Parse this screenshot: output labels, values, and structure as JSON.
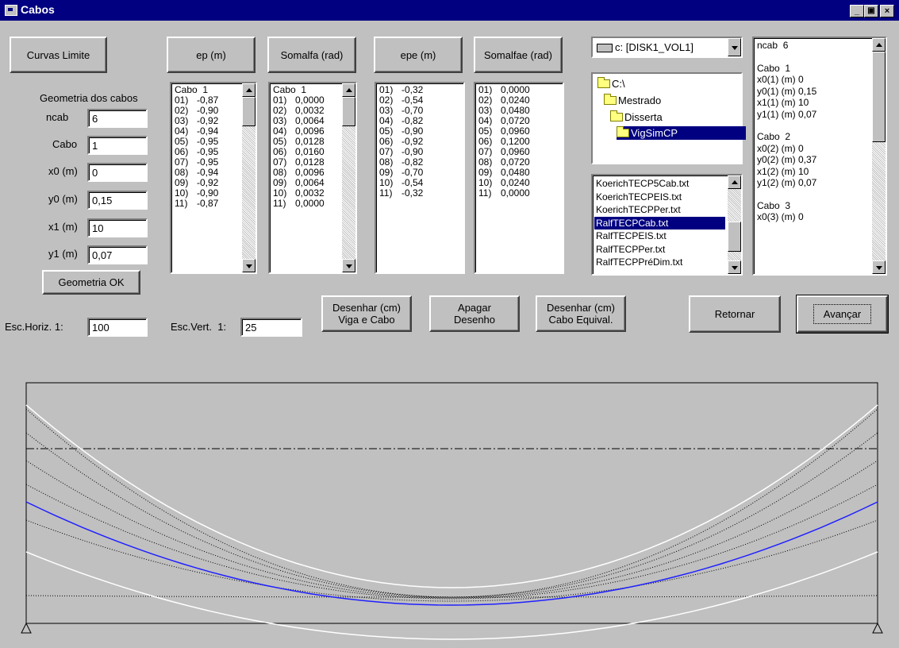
{
  "window": {
    "title": "Cabos",
    "min": "_",
    "max": " ",
    "close": "×"
  },
  "buttons": {
    "curvas_limite": "Curvas Limite",
    "ep": "ep (m)",
    "somalfa": "Somalfa (rad)",
    "epe": "epe (m)",
    "somalfae": "Somalfae (rad)",
    "geometria_ok": "Geometria OK",
    "desenhar_viga_l1": "Desenhar (cm)",
    "desenhar_viga_l2": "Viga e Cabo",
    "apagar_l1": "Apagar",
    "apagar_l2": "Desenho",
    "desenhar_cabo_l1": "Desenhar (cm)",
    "desenhar_cabo_l2": "Cabo Equival.",
    "retornar": "Retornar",
    "avancar": "Avançar"
  },
  "geometry": {
    "heading": "Geometria dos cabos",
    "ncab_label": "ncab",
    "ncab": "6",
    "cabo_label": "Cabo",
    "cabo": "1",
    "x0_label": "x0 (m)",
    "x0": "0",
    "y0_label": "y0 (m)",
    "y0": "0,15",
    "x1_label": "x1 (m)",
    "x1": "10",
    "y1_label": "y1 (m)",
    "y1": "0,07"
  },
  "scales": {
    "horiz_label": "Esc.Horiz. 1:",
    "horiz": "100",
    "vert_label": "Esc.Vert.  1:",
    "vert": "25"
  },
  "ep_list": {
    "header": "Cabo  1",
    "rows": [
      [
        "01)",
        "-0,87"
      ],
      [
        "02)",
        "-0,90"
      ],
      [
        "03)",
        "-0,92"
      ],
      [
        "04)",
        "-0,94"
      ],
      [
        "05)",
        "-0,95"
      ],
      [
        "06)",
        "-0,95"
      ],
      [
        "07)",
        "-0,95"
      ],
      [
        "08)",
        "-0,94"
      ],
      [
        "09)",
        "-0,92"
      ],
      [
        "10)",
        "-0,90"
      ],
      [
        "11)",
        "-0,87"
      ]
    ]
  },
  "somalfa_list": {
    "header": "Cabo  1",
    "rows": [
      [
        "01)",
        "0,0000"
      ],
      [
        "02)",
        "0,0032"
      ],
      [
        "03)",
        "0,0064"
      ],
      [
        "04)",
        "0,0096"
      ],
      [
        "05)",
        "0,0128"
      ],
      [
        "06)",
        "0,0160"
      ],
      [
        "07)",
        "0,0128"
      ],
      [
        "08)",
        "0,0096"
      ],
      [
        "09)",
        "0,0064"
      ],
      [
        "10)",
        "0,0032"
      ],
      [
        "11)",
        "0,0000"
      ]
    ]
  },
  "epe_list": {
    "rows": [
      [
        "01)",
        "-0,32"
      ],
      [
        "02)",
        "-0,54"
      ],
      [
        "03)",
        "-0,70"
      ],
      [
        "04)",
        "-0,82"
      ],
      [
        "05)",
        "-0,90"
      ],
      [
        "06)",
        "-0,92"
      ],
      [
        "07)",
        "-0,90"
      ],
      [
        "08)",
        "-0,82"
      ],
      [
        "09)",
        "-0,70"
      ],
      [
        "10)",
        "-0,54"
      ],
      [
        "11)",
        "-0,32"
      ]
    ]
  },
  "somalfae_list": {
    "rows": [
      [
        "01)",
        "0,0000"
      ],
      [
        "02)",
        "0,0240"
      ],
      [
        "03)",
        "0,0480"
      ],
      [
        "04)",
        "0,0720"
      ],
      [
        "05)",
        "0,0960"
      ],
      [
        "06)",
        "0,1200"
      ],
      [
        "07)",
        "0,0960"
      ],
      [
        "08)",
        "0,0720"
      ],
      [
        "09)",
        "0,0480"
      ],
      [
        "10)",
        "0,0240"
      ],
      [
        "11)",
        "0,0000"
      ]
    ]
  },
  "drive": "c: [DISK1_VOL1]",
  "dirs": [
    "C:\\",
    "Mestrado",
    "Disserta",
    "VigSimCP"
  ],
  "files": [
    "KoerichTECP5Cab.txt",
    "KoerichTECPEIS.txt",
    "KoerichTECPPer.txt",
    "RalfTECPCab.txt",
    "RalfTECPEIS.txt",
    "RalfTECPPer.txt",
    "RalfTECPPréDim.txt"
  ],
  "selected_file": "RalfTECPCab.txt",
  "info": {
    "ncab_line": "ncab  6",
    "blocks": [
      {
        "title": "Cabo  1",
        "lines": [
          [
            "x0(1) (m)",
            "0"
          ],
          [
            "y0(1) (m)",
            "0,15"
          ],
          [
            "x1(1) (m)",
            "10"
          ],
          [
            "y1(1) (m)",
            "0,07"
          ]
        ]
      },
      {
        "title": "Cabo  2",
        "lines": [
          [
            "x0(2) (m)",
            "0"
          ],
          [
            "y0(2) (m)",
            "0,37"
          ],
          [
            "x1(2) (m)",
            "10"
          ],
          [
            "y1(2) (m)",
            "0,07"
          ]
        ]
      },
      {
        "title": "Cabo  3",
        "lines": [
          [
            "x0(3) (m)",
            "0"
          ]
        ]
      }
    ]
  },
  "colors": {
    "title_bar": "#000080",
    "selection": "#000080",
    "cable_equivalent": "#2020ff",
    "limit_curves": "#ffffff"
  }
}
